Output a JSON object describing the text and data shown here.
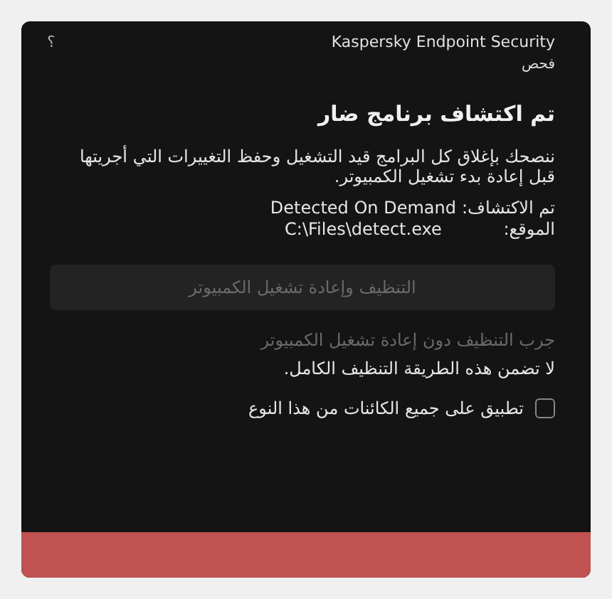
{
  "window": {
    "title": "Kaspersky Endpoint Security",
    "subtitle": "فحص",
    "help": "؟"
  },
  "heading": "تم اكتشاف برنامج ضار",
  "message": "ننصحك بإغلاق كل البرامج قيد التشغيل وحفظ التغييرات التي أجريتها قبل إعادة بدء تشغيل الكمبيوتر.",
  "details": [
    {
      "label": "تم الاكتشاف:",
      "value": "Detected On Demand"
    },
    {
      "label": "الموقع:",
      "value": "C:\\Files\\detect.exe"
    }
  ],
  "primary_button": {
    "label": "التنظيف وإعادة تشغيل الكمبيوتر",
    "disabled": true
  },
  "alt_link": {
    "label": "جرب التنظيف دون إعادة تشغيل الكمبيوتر",
    "disabled": true
  },
  "note": "لا تضمن هذه الطريقة التنظيف الكامل.",
  "apply_all": {
    "label": "تطبيق على جميع الكائنات من هذا النوع",
    "checked": false
  }
}
